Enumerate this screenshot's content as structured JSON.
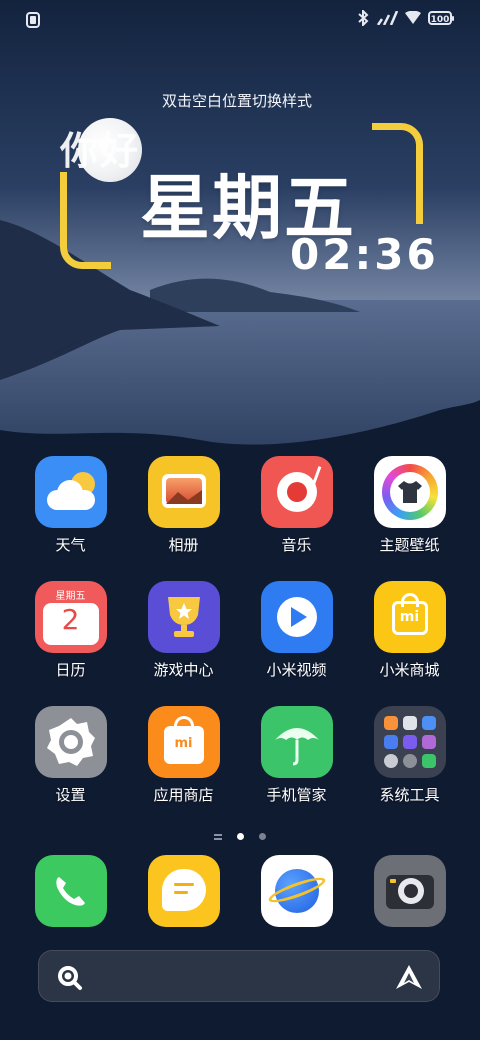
{
  "status_bar": {
    "battery_text": "100",
    "icons": [
      "screen-record-icon",
      "bluetooth-icon",
      "signal-icon",
      "wifi-icon",
      "battery-icon"
    ]
  },
  "widget": {
    "hint": "双击空白位置切换样式",
    "greeting": "你好",
    "weekday": "星期五",
    "time": "02:36",
    "accent": "#f4cd3c"
  },
  "apps": [
    {
      "label": "天气",
      "icon": "weather-icon",
      "color": "#3a8ef5"
    },
    {
      "label": "相册",
      "icon": "gallery-icon",
      "color": "#f7c427"
    },
    {
      "label": "音乐",
      "icon": "music-icon",
      "color": "#f05753"
    },
    {
      "label": "主题壁纸",
      "icon": "themes-icon",
      "color": "#ffffff"
    },
    {
      "label": "日历",
      "icon": "calendar-icon",
      "color": "#f15a5a",
      "icon_text_top": "星期五",
      "icon_text_num": "2"
    },
    {
      "label": "游戏中心",
      "icon": "game-center-icon",
      "color": "#5a4ed6"
    },
    {
      "label": "小米视频",
      "icon": "video-icon",
      "color": "#2f7bf2"
    },
    {
      "label": "小米商城",
      "icon": "mi-store-icon",
      "color": "#fbc614",
      "icon_text": "mi"
    },
    {
      "label": "设置",
      "icon": "settings-icon",
      "color": "#8d9097"
    },
    {
      "label": "应用商店",
      "icon": "app-store-icon",
      "color": "#fb8c1c",
      "icon_text": "mi"
    },
    {
      "label": "手机管家",
      "icon": "security-icon",
      "color": "#3cc46a"
    },
    {
      "label": "系统工具",
      "icon": "folder-icon",
      "color": "#3b4150"
    }
  ],
  "dock": [
    {
      "icon": "phone-icon",
      "color": "#3cc95f"
    },
    {
      "icon": "messages-icon",
      "color": "#fbc41e"
    },
    {
      "icon": "browser-icon",
      "color": "#ffffff"
    },
    {
      "icon": "camera-icon",
      "color": "#6c6f76"
    }
  ],
  "pages": {
    "current": 2,
    "total": 3
  },
  "search_bar": {
    "left_icon": "search-icon",
    "right_icon": "assistant-icon"
  }
}
